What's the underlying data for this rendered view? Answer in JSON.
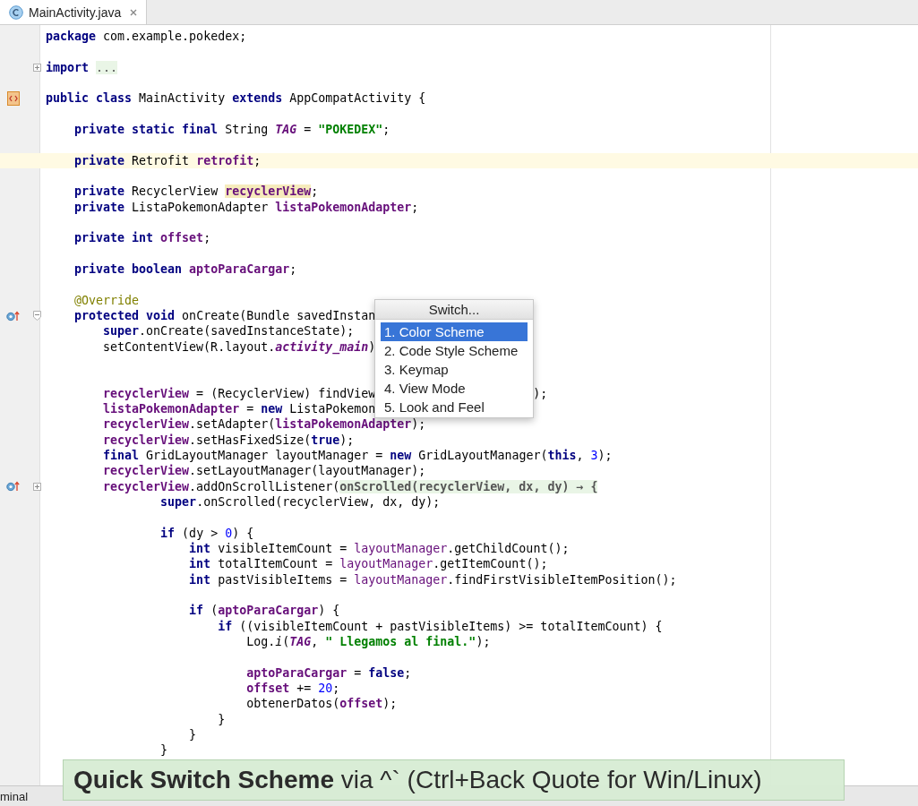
{
  "tab": {
    "label": "MainActivity.java",
    "selected": true
  },
  "lines": [
    {
      "tokens": [
        {
          "kind": "kw",
          "text": "package"
        },
        {
          "kind": "plain",
          "text": " com.example.pokedex;"
        }
      ]
    },
    {
      "blank_before": true,
      "fold": {
        "kind": "expand"
      },
      "tokens": [
        {
          "kind": "kw",
          "text": "import "
        },
        {
          "kind": "folded",
          "text": "..."
        }
      ]
    },
    {
      "blank_before": true,
      "gutter_marker": {
        "kind": "class"
      },
      "tokens": [
        {
          "kind": "kw",
          "text": "public class"
        },
        {
          "kind": "plain",
          "text": " MainActivity "
        },
        {
          "kind": "kw",
          "text": "extends"
        },
        {
          "kind": "plain",
          "text": " AppCompatActivity {"
        }
      ]
    },
    {
      "blank_before": true,
      "tokens": [
        {
          "kind": "kw",
          "text": "    private static final"
        },
        {
          "kind": "plain",
          "text": " String "
        },
        {
          "kind": "field-i",
          "text": "TAG"
        },
        {
          "kind": "plain",
          "text": " = "
        },
        {
          "kind": "str",
          "text": "\"POKEDEX\""
        },
        {
          "kind": "plain",
          "text": ";"
        }
      ]
    },
    {
      "blank_before": true,
      "current": true,
      "tokens": [
        {
          "kind": "kw",
          "text": "    private"
        },
        {
          "kind": "plain",
          "text": " Retrofit "
        },
        {
          "kind": "field",
          "text": "retrofit"
        },
        {
          "kind": "plain",
          "text": ";"
        }
      ]
    },
    {
      "blank_before": true,
      "tokens": [
        {
          "kind": "kw",
          "text": "    private"
        },
        {
          "kind": "plain",
          "text": " RecyclerView "
        },
        {
          "kind": "field-hl",
          "text": "recyclerView"
        },
        {
          "kind": "plain",
          "text": ";"
        }
      ]
    },
    {
      "tokens": [
        {
          "kind": "kw",
          "text": "    private"
        },
        {
          "kind": "plain",
          "text": " ListaPokemonAdapter "
        },
        {
          "kind": "field",
          "text": "listaPokemonAdapter"
        },
        {
          "kind": "plain",
          "text": ";"
        }
      ]
    },
    {
      "blank_before": true,
      "tokens": [
        {
          "kind": "kw",
          "text": "    private int "
        },
        {
          "kind": "field",
          "text": "offset"
        },
        {
          "kind": "plain",
          "text": ";"
        }
      ]
    },
    {
      "blank_before": true,
      "tokens": [
        {
          "kind": "kw",
          "text": "    private boolean "
        },
        {
          "kind": "field",
          "text": "aptoParaCargar"
        },
        {
          "kind": "plain",
          "text": ";"
        }
      ]
    },
    {
      "blank_before": true,
      "tokens": [
        {
          "kind": "ann",
          "text": "    @Override"
        }
      ]
    },
    {
      "gutter_marker": {
        "kind": "override"
      },
      "fold": {
        "kind": "collapse"
      },
      "tokens": [
        {
          "kind": "kw",
          "text": "    protected void"
        },
        {
          "kind": "plain",
          "text": " onCreate(Bundle savedInstan"
        }
      ]
    },
    {
      "tokens": [
        {
          "kind": "kw",
          "text": "        super"
        },
        {
          "kind": "plain",
          "text": ".onCreate(savedInstanceState);"
        }
      ]
    },
    {
      "blank_after": true,
      "tokens": [
        {
          "kind": "plain",
          "text": "        setContentView(R.layout."
        },
        {
          "kind": "field-i",
          "text": "activity_main"
        },
        {
          "kind": "plain",
          "text": ")"
        }
      ]
    },
    {
      "blank_before": true,
      "tokens": [
        {
          "kind": "field",
          "text": "        recyclerView"
        },
        {
          "kind": "plain",
          "text": " = (RecyclerView) findView"
        }
      ],
      "tail": [
        {
          "kind": "plain",
          "text": ");"
        }
      ]
    },
    {
      "tokens": [
        {
          "kind": "field",
          "text": "        listaPokemonAdapter"
        },
        {
          "kind": "plain",
          "text": " = "
        },
        {
          "kind": "kw",
          "text": "new"
        },
        {
          "kind": "plain",
          "text": " ListaPokemon"
        }
      ]
    },
    {
      "tokens": [
        {
          "kind": "field",
          "text": "        recyclerView"
        },
        {
          "kind": "plain",
          "text": ".setAdapter("
        },
        {
          "kind": "field",
          "text": "listaPokemonAdapter"
        },
        {
          "kind": "plain",
          "text": ");"
        }
      ]
    },
    {
      "tokens": [
        {
          "kind": "field",
          "text": "        recyclerView"
        },
        {
          "kind": "plain",
          "text": ".setHasFixedSize("
        },
        {
          "kind": "kw",
          "text": "true"
        },
        {
          "kind": "plain",
          "text": ");"
        }
      ]
    },
    {
      "tokens": [
        {
          "kind": "kw",
          "text": "        final"
        },
        {
          "kind": "plain",
          "text": " GridLayoutManager layoutManager = "
        },
        {
          "kind": "kw",
          "text": "new"
        },
        {
          "kind": "plain",
          "text": " GridLayoutManager("
        },
        {
          "kind": "kw",
          "text": "this"
        },
        {
          "kind": "plain",
          "text": ", "
        },
        {
          "kind": "num",
          "text": "3"
        },
        {
          "kind": "plain",
          "text": ");"
        }
      ]
    },
    {
      "tokens": [
        {
          "kind": "field",
          "text": "        recyclerView"
        },
        {
          "kind": "plain",
          "text": ".setLayoutManager(layoutManager);"
        }
      ]
    },
    {
      "gutter_marker": {
        "kind": "override"
      },
      "fold": {
        "kind": "expand"
      },
      "tokens": [
        {
          "kind": "field",
          "text": "        recyclerView"
        },
        {
          "kind": "plain",
          "text": ".addOnScrollListener("
        },
        {
          "kind": "lambda",
          "text": "onScrolled(recyclerView, dx, dy) → {"
        }
      ]
    },
    {
      "tokens": [
        {
          "kind": "kw",
          "text": "                super"
        },
        {
          "kind": "plain",
          "text": ".onScrolled(recyclerView, dx, dy);"
        }
      ]
    },
    {
      "blank_before": true,
      "tokens": [
        {
          "kind": "kw",
          "text": "                if"
        },
        {
          "kind": "plain",
          "text": " (dy > "
        },
        {
          "kind": "num",
          "text": "0"
        },
        {
          "kind": "plain",
          "text": ") {"
        }
      ]
    },
    {
      "tokens": [
        {
          "kind": "kw",
          "text": "                    int"
        },
        {
          "kind": "plain",
          "text": " visibleItemCount = "
        },
        {
          "kind": "captured",
          "text": "layoutManager"
        },
        {
          "kind": "plain",
          "text": ".getChildCount();"
        }
      ]
    },
    {
      "tokens": [
        {
          "kind": "kw",
          "text": "                    int"
        },
        {
          "kind": "plain",
          "text": " totalItemCount = "
        },
        {
          "kind": "captured",
          "text": "layoutManager"
        },
        {
          "kind": "plain",
          "text": ".getItemCount();"
        }
      ]
    },
    {
      "tokens": [
        {
          "kind": "kw",
          "text": "                    int"
        },
        {
          "kind": "plain",
          "text": " pastVisibleItems = "
        },
        {
          "kind": "captured",
          "text": "layoutManager"
        },
        {
          "kind": "plain",
          "text": ".findFirstVisibleItemPosition();"
        }
      ]
    },
    {
      "blank_before": true,
      "tokens": [
        {
          "kind": "kw",
          "text": "                    if"
        },
        {
          "kind": "plain",
          "text": " ("
        },
        {
          "kind": "field",
          "text": "aptoParaCargar"
        },
        {
          "kind": "plain",
          "text": ") {"
        }
      ]
    },
    {
      "tokens": [
        {
          "kind": "kw",
          "text": "                        if"
        },
        {
          "kind": "plain",
          "text": " ((visibleItemCount + pastVisibleItems) >= totalItemCount) {"
        }
      ]
    },
    {
      "tokens": [
        {
          "kind": "plain",
          "text": "                            Log."
        },
        {
          "kind": "method-i",
          "text": "i"
        },
        {
          "kind": "plain",
          "text": "("
        },
        {
          "kind": "field-i",
          "text": "TAG"
        },
        {
          "kind": "plain",
          "text": ", "
        },
        {
          "kind": "str",
          "text": "\" Llegamos al final.\""
        },
        {
          "kind": "plain",
          "text": ");"
        }
      ]
    },
    {
      "blank_before": true,
      "tokens": [
        {
          "kind": "field",
          "text": "                            aptoParaCargar"
        },
        {
          "kind": "plain",
          "text": " = "
        },
        {
          "kind": "kw",
          "text": "false"
        },
        {
          "kind": "plain",
          "text": ";"
        }
      ]
    },
    {
      "tokens": [
        {
          "kind": "field",
          "text": "                            offset"
        },
        {
          "kind": "plain",
          "text": " += "
        },
        {
          "kind": "num",
          "text": "20"
        },
        {
          "kind": "plain",
          "text": ";"
        }
      ]
    },
    {
      "tokens": [
        {
          "kind": "plain",
          "text": "                            obtenerDatos("
        },
        {
          "kind": "field",
          "text": "offset"
        },
        {
          "kind": "plain",
          "text": ");"
        }
      ]
    },
    {
      "tokens": [
        {
          "kind": "plain",
          "text": "                        }"
        }
      ]
    },
    {
      "tokens": [
        {
          "kind": "plain",
          "text": "                    }"
        }
      ]
    },
    {
      "tokens": [
        {
          "kind": "plain",
          "text": "                }"
        }
      ]
    }
  ],
  "popup": {
    "title": "Switch...",
    "items": [
      {
        "label": "1. Color Scheme",
        "selected": true
      },
      {
        "label": "2. Code Style Scheme",
        "selected": false
      },
      {
        "label": "3. Keymap",
        "selected": false
      },
      {
        "label": "4. View Mode",
        "selected": false
      },
      {
        "label": "5. Look and Feel",
        "selected": false
      }
    ]
  },
  "status_bar": {
    "tool_window": "minal"
  },
  "hint": "**Quick Switch Scheme** via ^` (Ctrl+Back Quote for Win/Linux)"
}
